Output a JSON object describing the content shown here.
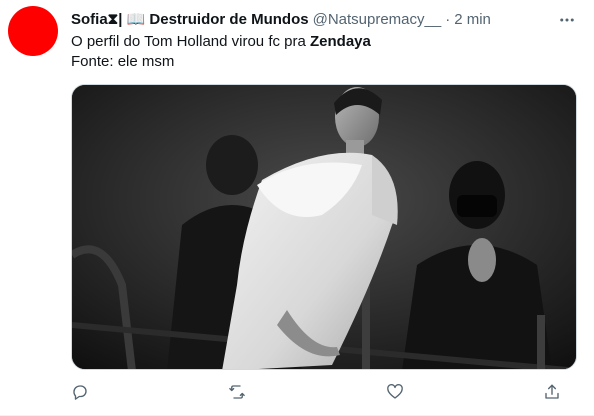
{
  "tweet": {
    "display_name": "Sofia⧗| 📖 Destruidor de Mundos",
    "handle": "@Natsupremacy__",
    "separator": "·",
    "time": "2 min",
    "text_line1_prefix": "O perfil do Tom Holland virou fc pra ",
    "text_line1_bold": "Zendaya",
    "text_line2": "Fonte: ele msm",
    "avatar_color": "#ff0000",
    "accent_color": "#536471"
  },
  "icons": {
    "more": "more-horizontal-icon",
    "reply": "reply-icon",
    "retweet": "retweet-icon",
    "like": "heart-icon",
    "share": "share-icon"
  }
}
